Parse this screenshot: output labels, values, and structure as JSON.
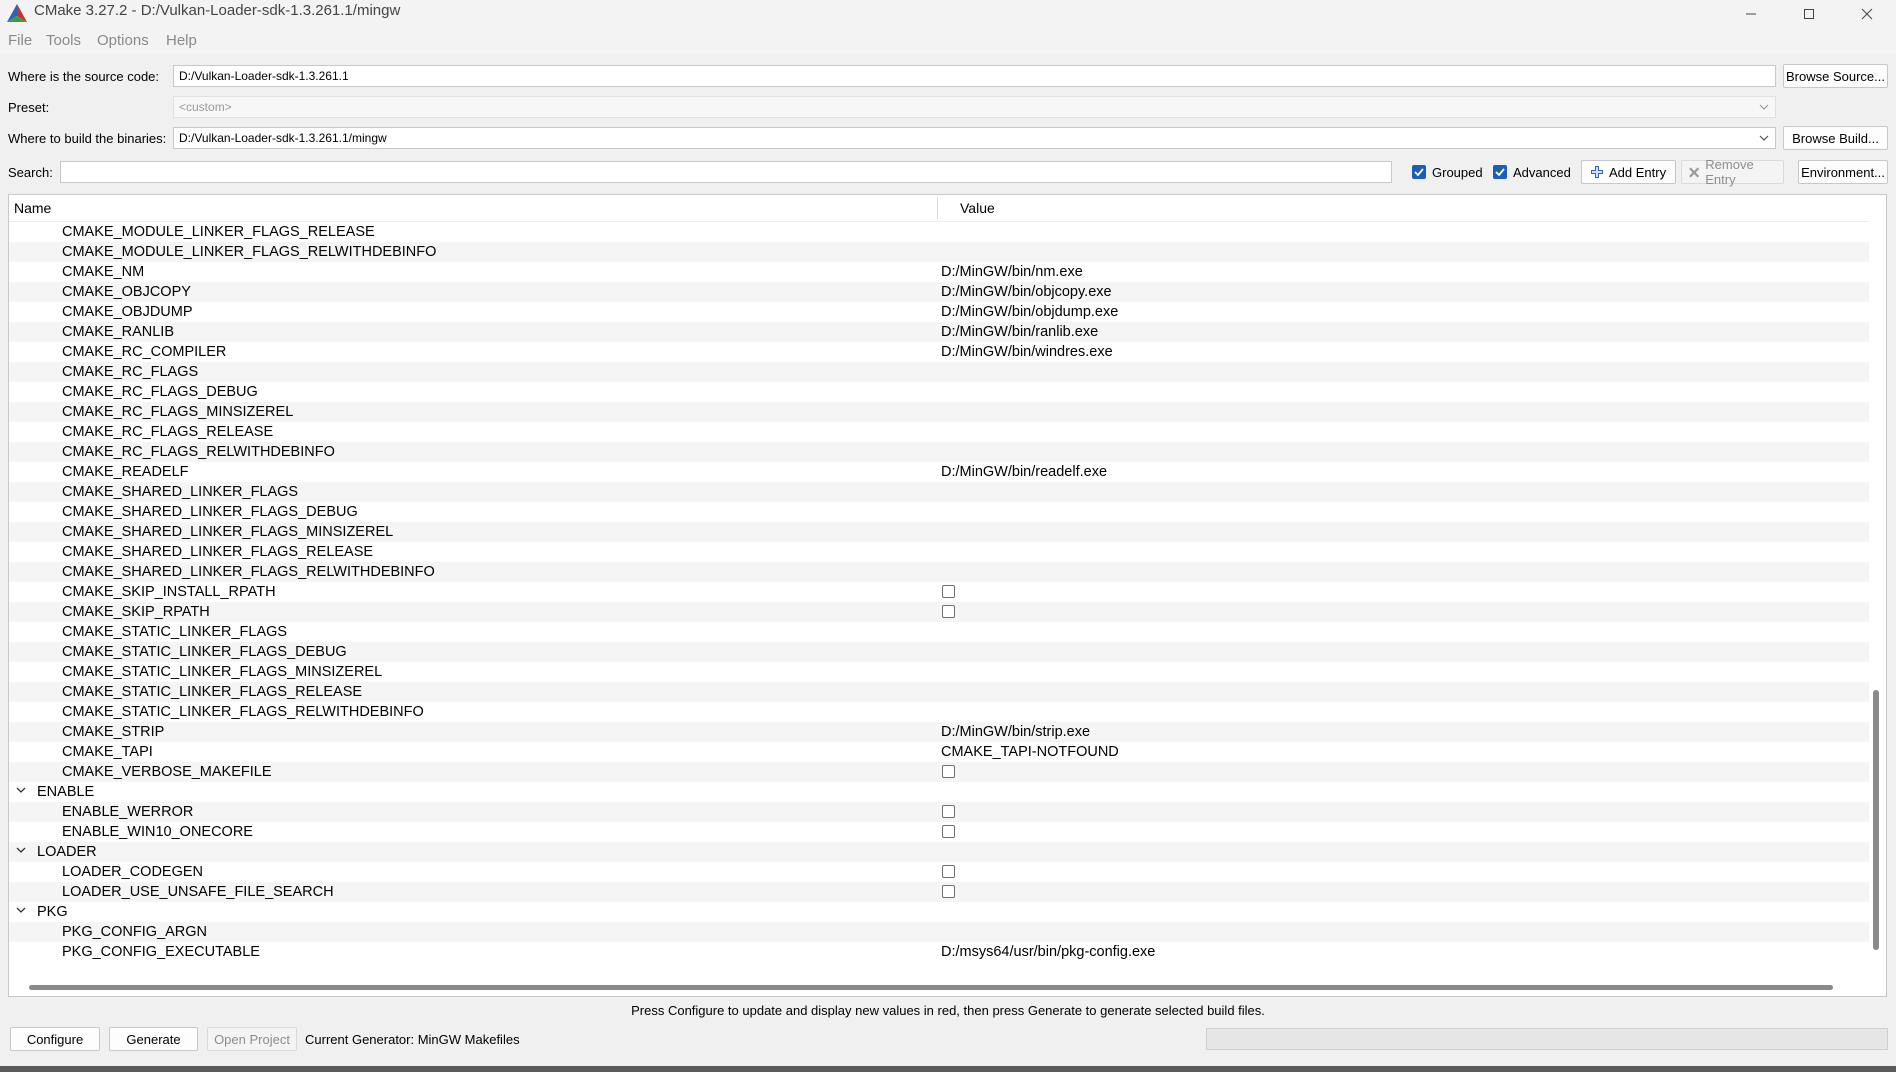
{
  "window": {
    "title": "CMake 3.27.2 - D:/Vulkan-Loader-sdk-1.3.261.1/mingw",
    "colors": {
      "accent": "#1a5fb4",
      "menu_text": "#8a8a8a"
    }
  },
  "menu": [
    "File",
    "Tools",
    "Options",
    "Help"
  ],
  "source": {
    "label": "Where is the source code:",
    "value": "D:/Vulkan-Loader-sdk-1.3.261.1",
    "button": "Browse Source..."
  },
  "preset": {
    "label": "Preset:",
    "value": "<custom>"
  },
  "build": {
    "label": "Where to build the binaries:",
    "value": "D:/Vulkan-Loader-sdk-1.3.261.1/mingw",
    "button": "Browse Build..."
  },
  "search": {
    "label": "Search:",
    "value": ""
  },
  "toolbar": {
    "grouped": {
      "label": "Grouped",
      "checked": true
    },
    "advanced": {
      "label": "Advanced",
      "checked": true
    },
    "add_entry": "Add Entry",
    "remove_entry": "Remove Entry",
    "environment": "Environment..."
  },
  "table": {
    "headers": {
      "name": "Name",
      "value": "Value"
    },
    "rows": [
      {
        "kind": "entry",
        "name": "CMAKE_MODULE_LINKER_FLAGS_RELEASE",
        "value": ""
      },
      {
        "kind": "entry",
        "name": "CMAKE_MODULE_LINKER_FLAGS_RELWITHDEBINFO",
        "value": ""
      },
      {
        "kind": "entry",
        "name": "CMAKE_NM",
        "value": "D:/MinGW/bin/nm.exe"
      },
      {
        "kind": "entry",
        "name": "CMAKE_OBJCOPY",
        "value": "D:/MinGW/bin/objcopy.exe"
      },
      {
        "kind": "entry",
        "name": "CMAKE_OBJDUMP",
        "value": "D:/MinGW/bin/objdump.exe"
      },
      {
        "kind": "entry",
        "name": "CMAKE_RANLIB",
        "value": "D:/MinGW/bin/ranlib.exe"
      },
      {
        "kind": "entry",
        "name": "CMAKE_RC_COMPILER",
        "value": "D:/MinGW/bin/windres.exe"
      },
      {
        "kind": "entry",
        "name": "CMAKE_RC_FLAGS",
        "value": ""
      },
      {
        "kind": "entry",
        "name": "CMAKE_RC_FLAGS_DEBUG",
        "value": ""
      },
      {
        "kind": "entry",
        "name": "CMAKE_RC_FLAGS_MINSIZEREL",
        "value": ""
      },
      {
        "kind": "entry",
        "name": "CMAKE_RC_FLAGS_RELEASE",
        "value": ""
      },
      {
        "kind": "entry",
        "name": "CMAKE_RC_FLAGS_RELWITHDEBINFO",
        "value": ""
      },
      {
        "kind": "entry",
        "name": "CMAKE_READELF",
        "value": "D:/MinGW/bin/readelf.exe"
      },
      {
        "kind": "entry",
        "name": "CMAKE_SHARED_LINKER_FLAGS",
        "value": ""
      },
      {
        "kind": "entry",
        "name": "CMAKE_SHARED_LINKER_FLAGS_DEBUG",
        "value": ""
      },
      {
        "kind": "entry",
        "name": "CMAKE_SHARED_LINKER_FLAGS_MINSIZEREL",
        "value": ""
      },
      {
        "kind": "entry",
        "name": "CMAKE_SHARED_LINKER_FLAGS_RELEASE",
        "value": ""
      },
      {
        "kind": "entry",
        "name": "CMAKE_SHARED_LINKER_FLAGS_RELWITHDEBINFO",
        "value": ""
      },
      {
        "kind": "bool",
        "name": "CMAKE_SKIP_INSTALL_RPATH",
        "checked": false
      },
      {
        "kind": "bool",
        "name": "CMAKE_SKIP_RPATH",
        "checked": false
      },
      {
        "kind": "entry",
        "name": "CMAKE_STATIC_LINKER_FLAGS",
        "value": ""
      },
      {
        "kind": "entry",
        "name": "CMAKE_STATIC_LINKER_FLAGS_DEBUG",
        "value": ""
      },
      {
        "kind": "entry",
        "name": "CMAKE_STATIC_LINKER_FLAGS_MINSIZEREL",
        "value": ""
      },
      {
        "kind": "entry",
        "name": "CMAKE_STATIC_LINKER_FLAGS_RELEASE",
        "value": ""
      },
      {
        "kind": "entry",
        "name": "CMAKE_STATIC_LINKER_FLAGS_RELWITHDEBINFO",
        "value": ""
      },
      {
        "kind": "entry",
        "name": "CMAKE_STRIP",
        "value": "D:/MinGW/bin/strip.exe"
      },
      {
        "kind": "entry",
        "name": "CMAKE_TAPI",
        "value": "CMAKE_TAPI-NOTFOUND"
      },
      {
        "kind": "bool",
        "name": "CMAKE_VERBOSE_MAKEFILE",
        "checked": false
      },
      {
        "kind": "group",
        "name": "ENABLE"
      },
      {
        "kind": "bool",
        "name": "ENABLE_WERROR",
        "checked": false
      },
      {
        "kind": "bool",
        "name": "ENABLE_WIN10_ONECORE",
        "checked": false
      },
      {
        "kind": "group",
        "name": "LOADER"
      },
      {
        "kind": "bool",
        "name": "LOADER_CODEGEN",
        "checked": false
      },
      {
        "kind": "bool",
        "name": "LOADER_USE_UNSAFE_FILE_SEARCH",
        "checked": false
      },
      {
        "kind": "group",
        "name": "PKG"
      },
      {
        "kind": "entry",
        "name": "PKG_CONFIG_ARGN",
        "value": ""
      },
      {
        "kind": "entry",
        "name": "PKG_CONFIG_EXECUTABLE",
        "value": "D:/msys64/usr/bin/pkg-config.exe"
      }
    ]
  },
  "status": {
    "message": "Press Configure to update and display new values in red, then press Generate to generate selected build files."
  },
  "footer": {
    "configure": "Configure",
    "generate": "Generate",
    "open_project": "Open Project",
    "generator": "Current Generator: MinGW Makefiles"
  }
}
